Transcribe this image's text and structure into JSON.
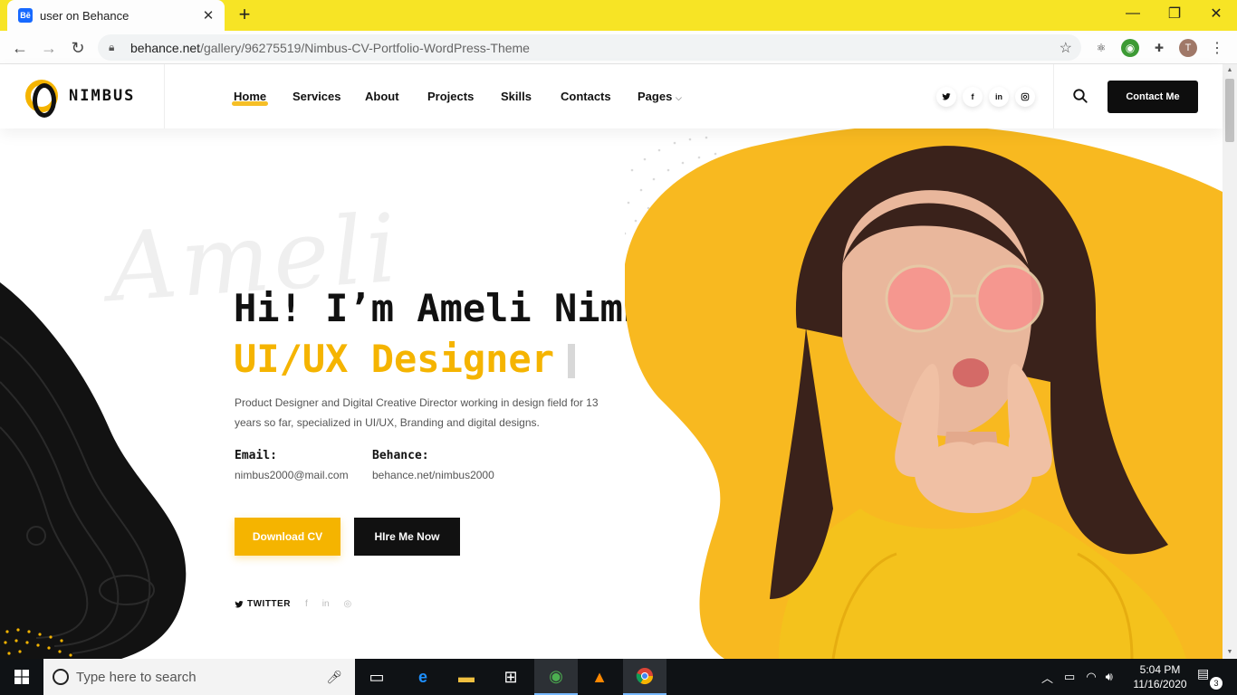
{
  "browser": {
    "tab_title": "user on Behance",
    "favicon_text": "Bē",
    "url_domain": "behance.net",
    "url_path": "/gallery/96275519/Nimbus-CV-Portfolio-WordPress-Theme",
    "profile_initial": "T"
  },
  "site": {
    "brand": "NIMBUS",
    "nav": [
      "Home",
      "Services",
      "About",
      "Projects",
      "Skills",
      "Contacts",
      "Pages"
    ],
    "active_nav": "Home",
    "social": [
      "twitter-icon",
      "facebook-icon",
      "linkedin-icon",
      "instagram-icon"
    ],
    "contact_button": "Contact Me"
  },
  "hero": {
    "script_word": "Ameli",
    "headline": "Hi! I’m Ameli Nimbus -",
    "role": "UI/UX Designer",
    "description": "Product Designer and Digital Creative Director working in design field for 13 years so far, specialized in UI/UX, Branding and digital designs.",
    "email_label": "Email:",
    "email_value": "nimbus2000@mail.com",
    "behance_label": "Behance:",
    "behance_value": "behance.net/nimbus2000",
    "download_button": "Download CV",
    "hire_button": "HIre Me Now",
    "twitter_label": "TWITTER",
    "accent_color": "#f5b400"
  },
  "taskbar": {
    "search_placeholder": "Type here to search",
    "time": "5:04 PM",
    "date": "11/16/2020",
    "notification_count": "3"
  }
}
